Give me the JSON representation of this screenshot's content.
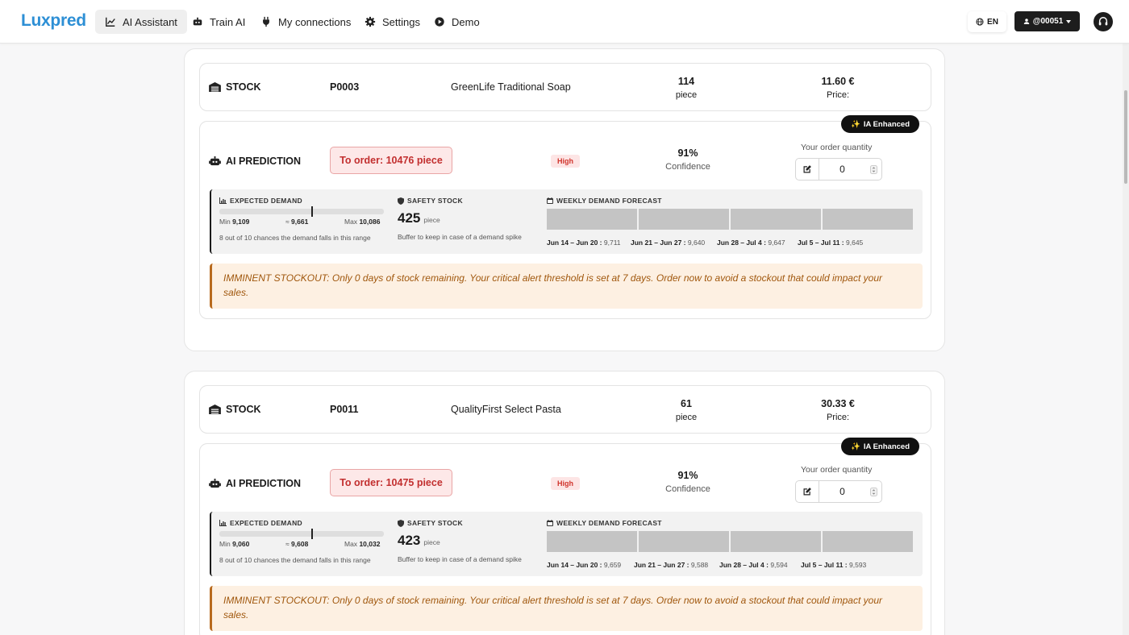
{
  "brand": {
    "logo": "Luxpred"
  },
  "nav": {
    "items": [
      {
        "label": "AI Assistant",
        "icon": "chart-line-icon",
        "active": true
      },
      {
        "label": "Train AI",
        "icon": "robot-icon"
      },
      {
        "label": "My connections",
        "icon": "plug-icon"
      },
      {
        "label": "Settings",
        "icon": "gear-icon"
      },
      {
        "label": "Demo",
        "icon": "play-icon"
      }
    ],
    "language": "EN",
    "user": "@00051"
  },
  "labels": {
    "stock": "STOCK",
    "ai_prediction": "AI PREDICTION",
    "piece": "piece",
    "price": "Price:",
    "ia_enhanced": "IA Enhanced",
    "confidence": "Confidence",
    "your_order_quantity": "Your order quantity",
    "expected_demand": "EXPECTED DEMAND",
    "safety_stock": "SAFETY STOCK",
    "weekly_forecast": "WEEKLY DEMAND FORECAST",
    "min": "Min",
    "max": "Max",
    "approx": "≈",
    "chance_text": "8 out of 10 chances the demand falls in this range",
    "buffer_text": "Buffer to keep in case of a demand spike"
  },
  "products": [
    {
      "code": "P0003",
      "name": "GreenLife Traditional Soap",
      "stock_qty": "114",
      "price": "11.60 €",
      "order_text": "To order: 10476 piece",
      "priority": "High",
      "confidence": "91%",
      "order_quantity": "0",
      "demand_min": "9,109",
      "demand_expected": "9,661",
      "demand_max": "10,086",
      "demand_position": 0.56,
      "safety_stock": "425",
      "weeks": [
        {
          "range": "Jun 14 – Jun 20 :",
          "value": "9,711"
        },
        {
          "range": "Jun 21 – Jun 27 :",
          "value": "9,640"
        },
        {
          "range": "Jun 28 – Jul 4 :",
          "value": "9,647"
        },
        {
          "range": "Jul 5 – Jul 11 :",
          "value": "9,645"
        }
      ],
      "alert": "IMMINENT STOCKOUT: Only 0 days of stock remaining. Your critical alert threshold is set at 7 days. Order now to avoid a stockout that could impact your sales."
    },
    {
      "code": "P0011",
      "name": "QualityFirst Select Pasta",
      "stock_qty": "61",
      "price": "30.33 €",
      "order_text": "To order: 10475 piece",
      "priority": "High",
      "confidence": "91%",
      "order_quantity": "0",
      "demand_min": "9,060",
      "demand_expected": "9,608",
      "demand_max": "10,032",
      "demand_position": 0.56,
      "safety_stock": "423",
      "weeks": [
        {
          "range": "Jun 14 – Jun 20 :",
          "value": "9,659"
        },
        {
          "range": "Jun 21 – Jun 27 :",
          "value": "9,588"
        },
        {
          "range": "Jun 28 – Jul 4 :",
          "value": "9,594"
        },
        {
          "range": "Jul 5 – Jul 11 :",
          "value": "9,593"
        }
      ],
      "alert": "IMMINENT STOCKOUT: Only 0 days of stock remaining. Your critical alert threshold is set at 7 days. Order now to avoid a stockout that could impact your sales."
    }
  ]
}
